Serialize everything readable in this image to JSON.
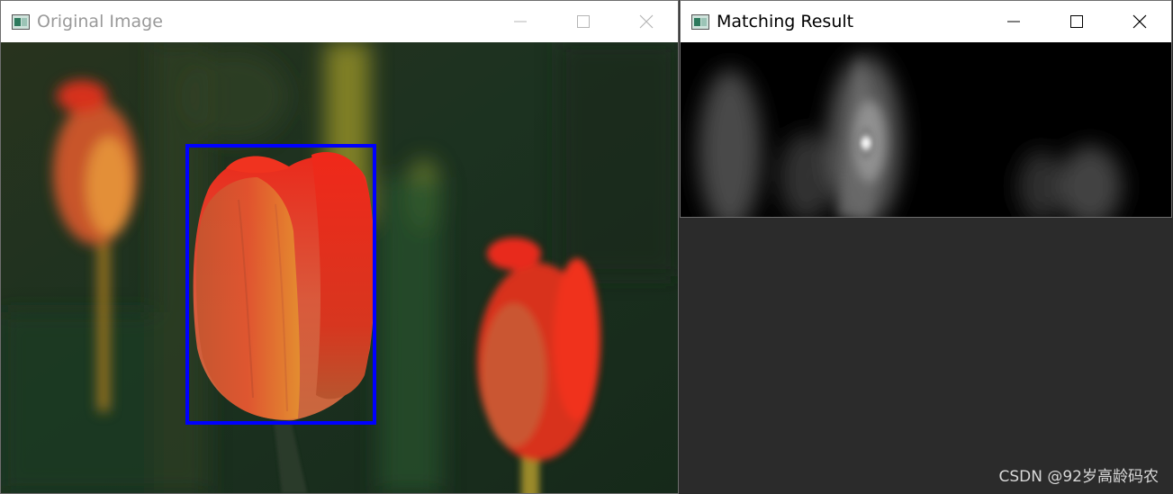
{
  "windows": [
    {
      "title": "Original Image",
      "active": false
    },
    {
      "title": "Matching Result",
      "active": true
    }
  ],
  "icons": {
    "minimize": "minimize-icon",
    "maximize": "maximize-icon",
    "close": "close-icon",
    "app": "opencv-window-icon"
  },
  "watermark": "CSDN @92岁高龄码农",
  "colors": {
    "match_box": "#0000ff",
    "tulip_red": "#e3241c",
    "background_green": "#1f3420"
  }
}
